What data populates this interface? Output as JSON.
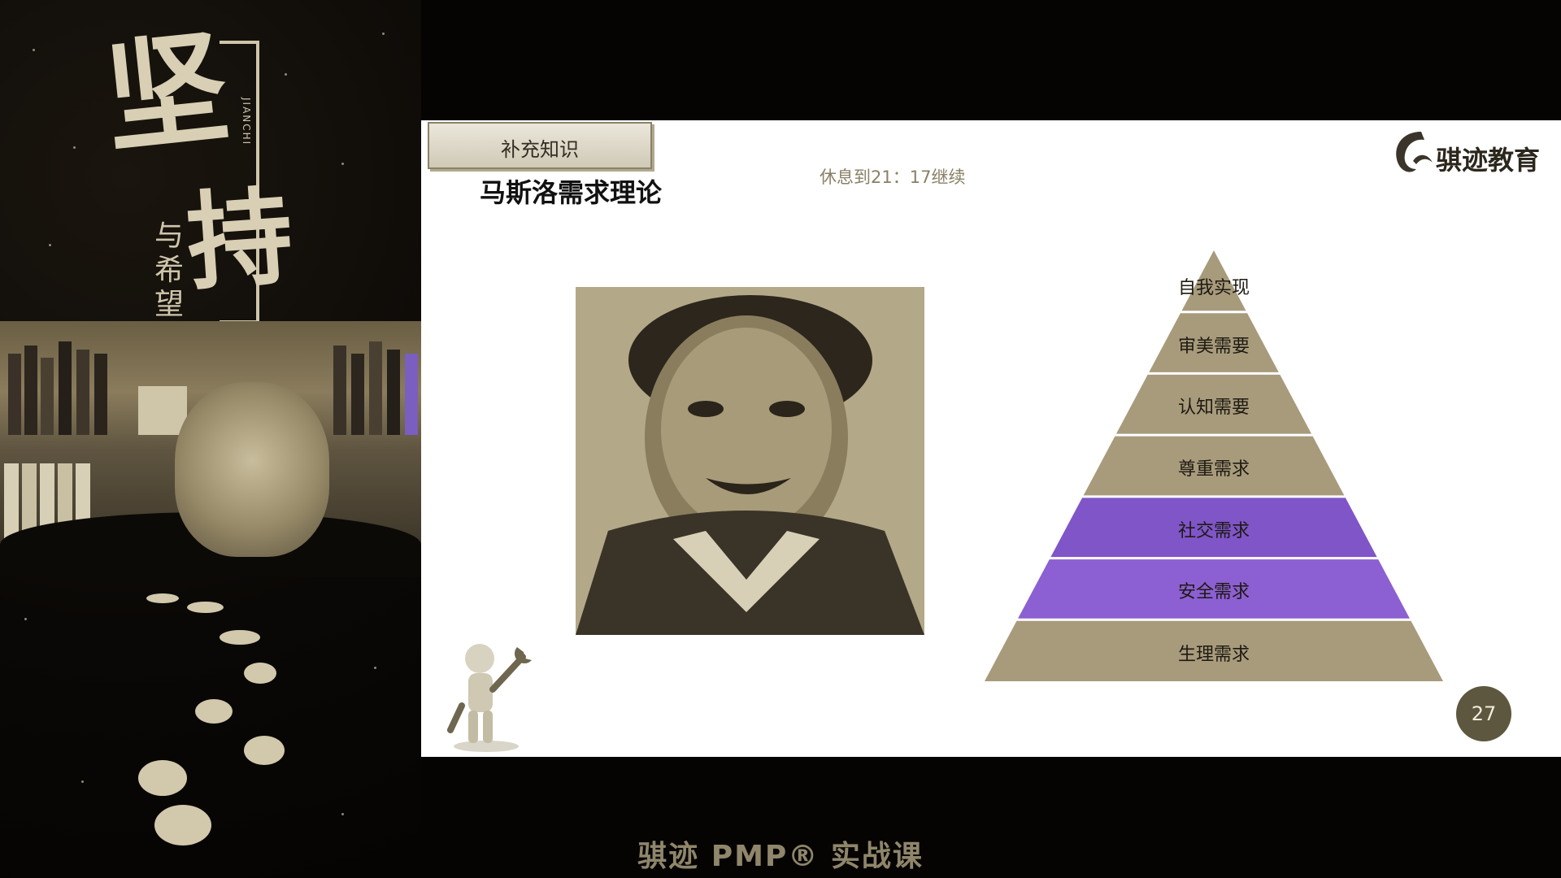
{
  "poster": {
    "big_char_1": "坚",
    "big_char_2": "持",
    "small_chars": "与希望",
    "pinyin": "JIANCHI"
  },
  "slide": {
    "badge": "补充知识",
    "title": "马斯洛需求理论",
    "break_notice": "休息到21：17继续",
    "logo_text": "骐迹教育",
    "page_number": "27",
    "pyramid": [
      {
        "label": "自我实现",
        "color": "#a89b7c"
      },
      {
        "label": "审美需要",
        "color": "#a89b7c"
      },
      {
        "label": "认知需要",
        "color": "#a89b7c"
      },
      {
        "label": "尊重需求",
        "color": "#a89b7c"
      },
      {
        "label": "社交需求",
        "color": "#7f55c8"
      },
      {
        "label": "安全需求",
        "color": "#8c5fd2"
      },
      {
        "label": "生理需求",
        "color": "#a89b7c"
      }
    ]
  },
  "footer": {
    "caption": "骐迹 PMP® 实战课"
  }
}
